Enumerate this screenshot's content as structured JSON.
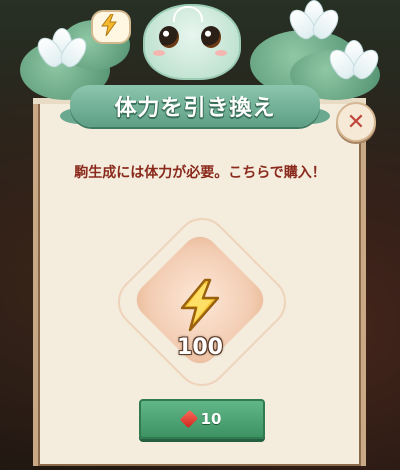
{
  "dialog": {
    "title": "体力を引き換え",
    "message": "駒生成には体力が必要。こちらで購入！",
    "close_symbol": "✕",
    "item": {
      "icon": "lightning-bolt-icon",
      "amount": "100"
    },
    "buy_button": {
      "price": "10",
      "currency_icon": "red-gem-icon"
    }
  },
  "mascot": {
    "speech_icon": "lightning-bolt-icon"
  },
  "colors": {
    "title_banner": "#6aa890",
    "message_text": "#8a2a1c",
    "button_green": "#3e9363",
    "bolt_yellow": "#f5b82e",
    "close_red": "#c0453a"
  }
}
